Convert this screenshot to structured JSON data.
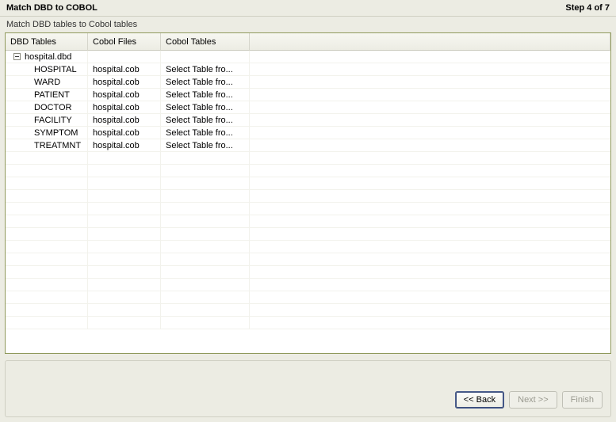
{
  "header": {
    "title": "Match DBD to COBOL",
    "step": "Step 4 of 7"
  },
  "subtitle": "Match DBD tables to Cobol tables",
  "columns": {
    "dbd": "DBD Tables",
    "file": "Cobol Files",
    "ctab": "Cobol Tables"
  },
  "tree": {
    "root": "hospital.dbd",
    "rows": [
      {
        "dbd": "HOSPITAL",
        "file": "hospital.cob",
        "ctab": "Select Table fro..."
      },
      {
        "dbd": "WARD",
        "file": "hospital.cob",
        "ctab": "Select Table fro..."
      },
      {
        "dbd": "PATIENT",
        "file": "hospital.cob",
        "ctab": "Select Table fro..."
      },
      {
        "dbd": "DOCTOR",
        "file": "hospital.cob",
        "ctab": "Select Table fro..."
      },
      {
        "dbd": "FACILITY",
        "file": "hospital.cob",
        "ctab": "Select Table fro..."
      },
      {
        "dbd": "SYMPTOM",
        "file": "hospital.cob",
        "ctab": "Select Table fro..."
      },
      {
        "dbd": "TREATMNT",
        "file": "hospital.cob",
        "ctab": "Select Table fro..."
      }
    ]
  },
  "buttons": {
    "back": "<< Back",
    "next": "Next >>",
    "finish": "Finish"
  }
}
